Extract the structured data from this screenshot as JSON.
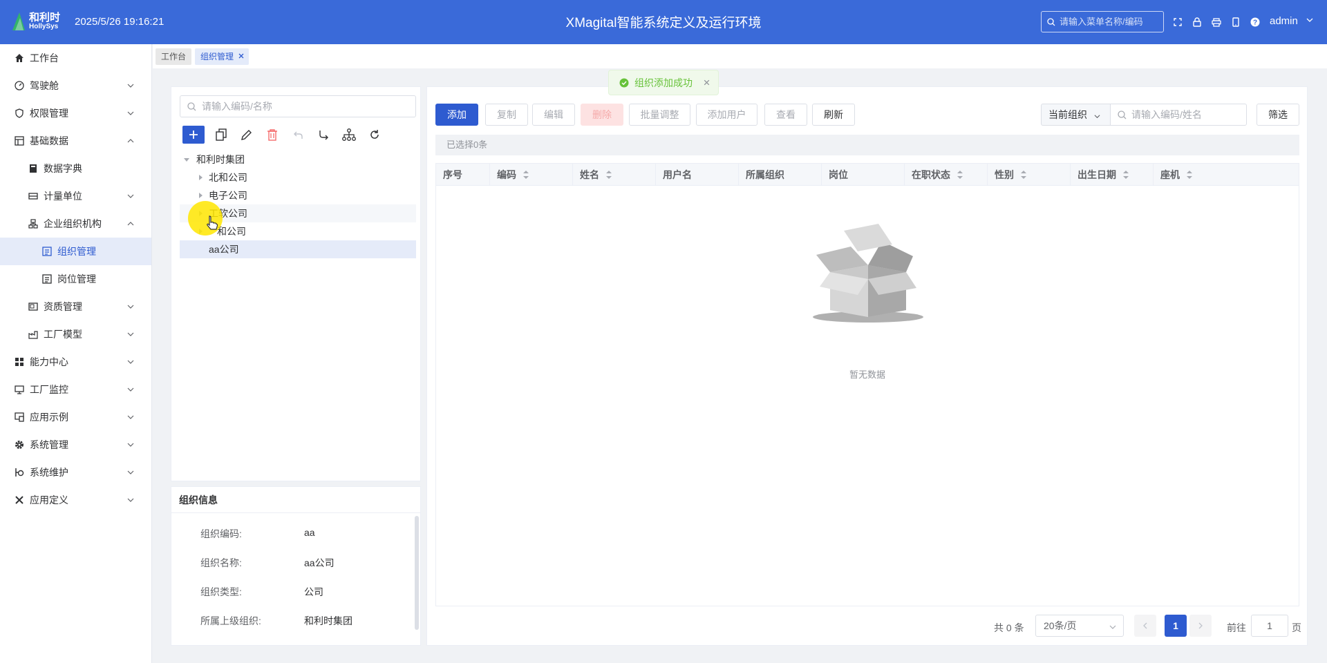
{
  "header": {
    "logo_cn": "和利时",
    "logo_en": "HollySys",
    "datetime": "2025/5/26 19:16:21",
    "title": "XMagital智能系统定义及运行环境",
    "menu_search_placeholder": "请输入菜单名称/编码",
    "user": "admin",
    "icons": [
      "fullscreen-icon",
      "lock-icon",
      "print-icon",
      "mobile-icon",
      "help-icon"
    ]
  },
  "sidebar": {
    "items": [
      {
        "label": "工作台",
        "icon": "home-icon"
      },
      {
        "label": "驾驶舱",
        "icon": "dashboard-icon"
      },
      {
        "label": "权限管理",
        "icon": "shield-icon"
      },
      {
        "label": "基础数据",
        "icon": "grid-icon"
      },
      {
        "label": "数据字典",
        "icon": "book-icon"
      },
      {
        "label": "计量单位",
        "icon": "ruler-icon"
      },
      {
        "label": "企业组织机构",
        "icon": "org-icon"
      },
      {
        "label": "组织管理",
        "icon": "list-icon"
      },
      {
        "label": "岗位管理",
        "icon": "list-icon"
      },
      {
        "label": "资质管理",
        "icon": "certificate-icon"
      },
      {
        "label": "工厂模型",
        "icon": "factory-icon"
      },
      {
        "label": "能力中心",
        "icon": "apps-icon"
      },
      {
        "label": "工厂监控",
        "icon": "monitor-icon"
      },
      {
        "label": "应用示例",
        "icon": "example-icon"
      },
      {
        "label": "系统管理",
        "icon": "gear-icon"
      },
      {
        "label": "系统维护",
        "icon": "wrench-icon"
      },
      {
        "label": "应用定义",
        "icon": "tools-icon"
      }
    ]
  },
  "tabs": [
    {
      "label": "工作台"
    },
    {
      "label": "组织管理"
    }
  ],
  "toast": {
    "message": "组织添加成功",
    "status_color": "#67c23a"
  },
  "tree": {
    "search_placeholder": "请输入编码/名称",
    "nodes": [
      {
        "label": "和利时集团"
      },
      {
        "label": "北和公司"
      },
      {
        "label": "电子公司"
      },
      {
        "label": "工软公司"
      },
      {
        "label": "和公司"
      },
      {
        "label": "aa公司"
      }
    ]
  },
  "org_info": {
    "title": "组织信息",
    "rows": [
      {
        "key": "组织编码:",
        "value": "aa"
      },
      {
        "key": "组织名称:",
        "value": "aa公司"
      },
      {
        "key": "组织类型:",
        "value": "公司"
      },
      {
        "key": "所属上级组织:",
        "value": "和利时集团"
      }
    ]
  },
  "toolbar": {
    "add": "添加",
    "copy": "复制",
    "edit": "编辑",
    "delete": "删除",
    "batch": "批量调整",
    "add_user": "添加用户",
    "view": "查看",
    "refresh": "刷新",
    "org_select": "当前组织",
    "user_search_placeholder": "请输入编码/姓名",
    "filter": "筛选"
  },
  "table": {
    "selected_text": "已选择0条",
    "columns": [
      {
        "label": "序号"
      },
      {
        "label": "编码"
      },
      {
        "label": "姓名"
      },
      {
        "label": "用户名"
      },
      {
        "label": "所属组织"
      },
      {
        "label": "岗位"
      },
      {
        "label": "在职状态"
      },
      {
        "label": "性别"
      },
      {
        "label": "出生日期"
      },
      {
        "label": "座机"
      }
    ],
    "empty_text": "暂无数据"
  },
  "pager": {
    "total": "共 0 条",
    "page_size": "20条/页",
    "current": "1",
    "goto_label": "前往",
    "goto_value": "1",
    "goto_suffix": "页"
  },
  "colors": {
    "primary": "#2e5bd0",
    "header": "#3a6ad9",
    "success": "#67c23a"
  }
}
